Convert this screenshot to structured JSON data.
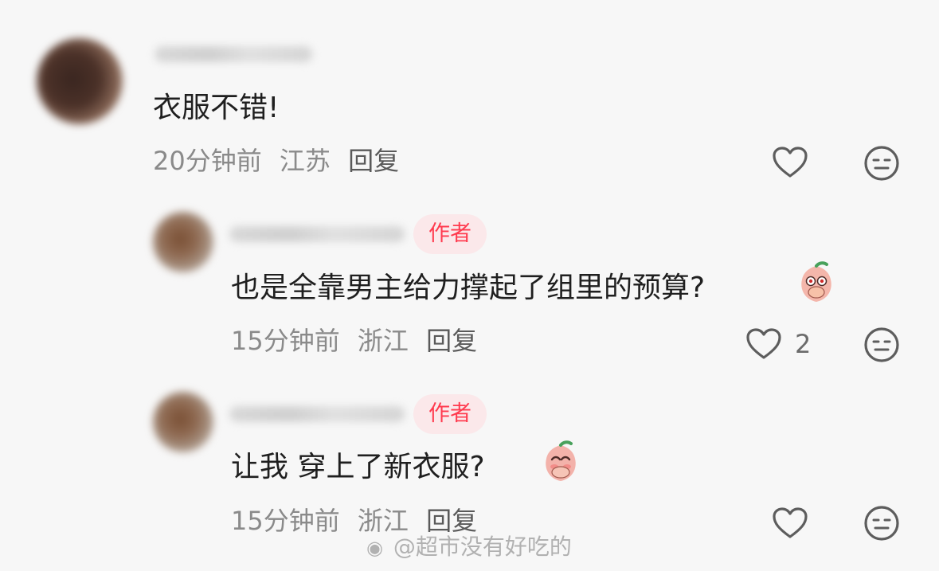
{
  "comments": [
    {
      "text": "衣服不错!",
      "time": "20分钟前",
      "location": "江苏",
      "reply_label": "回复"
    },
    {
      "badge": "作者",
      "text": "也是全靠男主给力撑起了组里的预算?",
      "time": "15分钟前",
      "location": "浙江",
      "reply_label": "回复",
      "like_count": "2"
    },
    {
      "badge": "作者",
      "text": "让我 穿上了新衣服?",
      "time": "15分钟前",
      "location": "浙江",
      "reply_label": "回复"
    }
  ],
  "watermark": {
    "text": "@超市没有好吃的"
  },
  "icons": {
    "like": "heart-outline-icon",
    "dislike": "neutral-face-icon",
    "weibo": "weibo-logo-icon",
    "sticker_1": "peach-covering-mouth-sticker",
    "sticker_2": "peach-smug-sticker"
  }
}
